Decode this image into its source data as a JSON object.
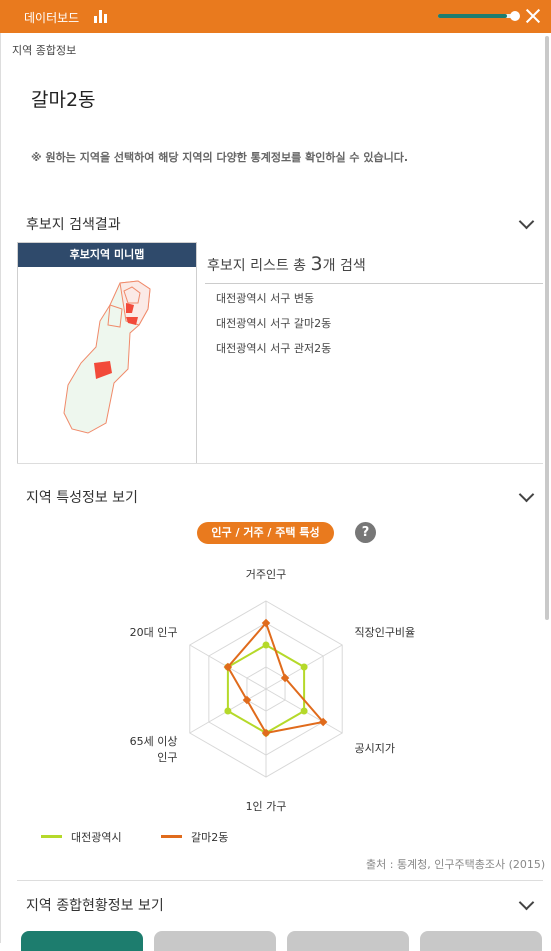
{
  "header": {
    "title": "데이터보드",
    "zoom_level": 0.88,
    "colors": {
      "bar": "#e97a1e",
      "slider": "#1d7d6e"
    }
  },
  "breadcrumb": "지역 종합정보",
  "region_name": "갈마2동",
  "notice": "※ 원하는 지역을 선택하여 해당 지역의 다양한 통계정보를 확인하실 수 있습니다.",
  "candidates": {
    "section_title": "후보지 검색결과",
    "minimap_title": "후보지역 미니맵",
    "list_prefix": "후보지 리스트 총",
    "count": "3",
    "list_suffix": "개 검색",
    "items": [
      "대전광역시 서구 변동",
      "대전광역시 서구 갈마2동",
      "대전광역시 서구 관저2동"
    ]
  },
  "characteristics": {
    "section_title": "지역 특성정보 보기",
    "pill_label": "인구 / 거주 / 주택 특성",
    "help": "?",
    "source": "출처 : 통계청, 인구주택총조사 (2015)"
  },
  "chart_data": {
    "type": "radar",
    "axes": [
      "거주인구",
      "직장인구비율",
      "공시지가",
      "1인 가구",
      "65세 이상 인구",
      "20대 인구"
    ],
    "axis_label_lines": [
      [
        "거주인구"
      ],
      [
        "직장인구비율"
      ],
      [
        "공시지가"
      ],
      [
        "1인 가구"
      ],
      [
        "65세 이상",
        "인구"
      ],
      [
        "20대 인구"
      ]
    ],
    "rlim": [
      0,
      4
    ],
    "levels": 4,
    "series": [
      {
        "name": "대전광역시",
        "color": "#b5d92a",
        "values": [
          2,
          2,
          2,
          2,
          2,
          2
        ]
      },
      {
        "name": "갈마2동",
        "color": "#e06b1c",
        "values": [
          3,
          1,
          3,
          2,
          1,
          2
        ]
      }
    ]
  },
  "overview": {
    "section_title": "지역 종합현황정보 보기",
    "button_colors": [
      "#1d7d6e",
      "#c8c8c8",
      "#c8c8c8",
      "#c8c8c8"
    ]
  }
}
